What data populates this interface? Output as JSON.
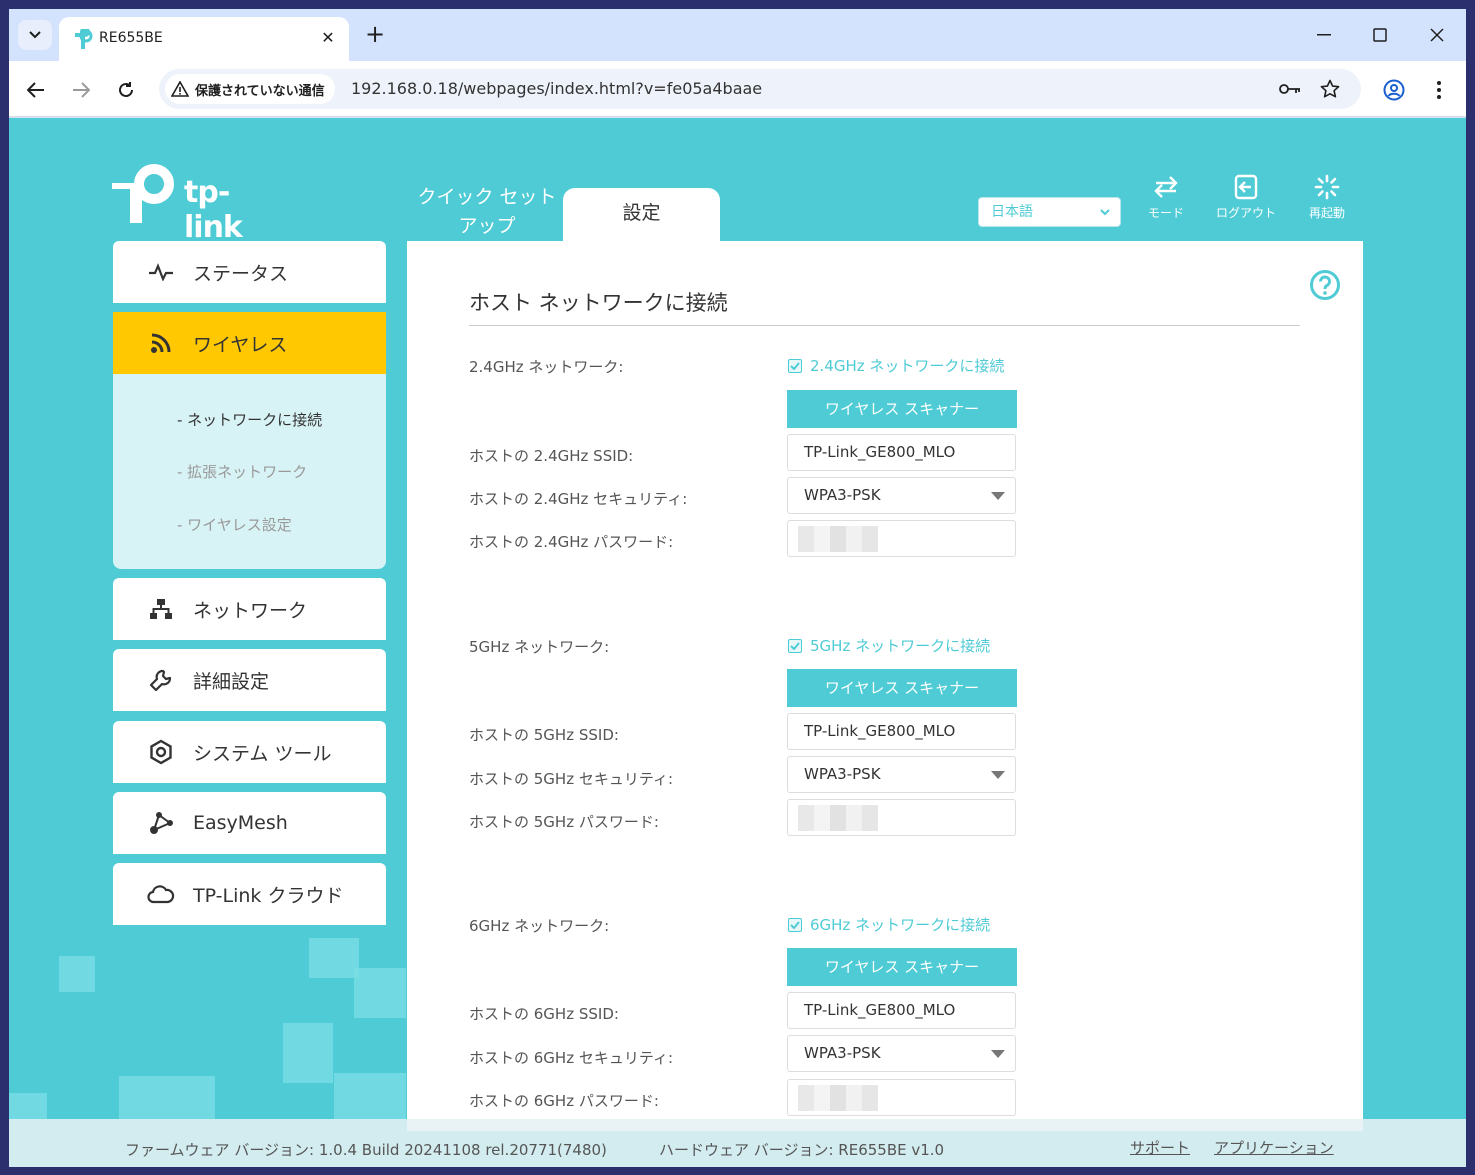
{
  "browser": {
    "tab_title": "RE655BE",
    "security_label": "保護されていない通信",
    "url": "192.168.0.18/webpages/index.html?v=fe05a4baae"
  },
  "brand": {
    "logo_text": "tp-link",
    "accent": "#4ecbd5",
    "active_menu": "#ffc800"
  },
  "header": {
    "quick_setup": "クイック セット アップ",
    "settings_tab": "設定",
    "language": "日本語",
    "mode_label": "モード",
    "logout_label": "ログアウト",
    "reboot_label": "再起動"
  },
  "sidebar": {
    "items": [
      {
        "label": "ステータス",
        "icon": "pulse-icon"
      },
      {
        "label": "ワイヤレス",
        "icon": "wifi-icon"
      },
      {
        "label": "ネットワーク",
        "icon": "network-icon"
      },
      {
        "label": "詳細設定",
        "icon": "wrench-icon"
      },
      {
        "label": "システム ツール",
        "icon": "gear-icon"
      },
      {
        "label": "EasyMesh",
        "icon": "mesh-icon"
      },
      {
        "label": "TP-Link クラウド",
        "icon": "cloud-icon"
      }
    ],
    "submenu": [
      "- ネットワークに接続",
      "- 拡張ネットワーク",
      "- ワイヤレス設定"
    ]
  },
  "main": {
    "title": "ホスト ネットワークに接続",
    "bands": [
      {
        "network_label": "2.4GHz ネットワーク:",
        "connect_label": "2.4GHz ネットワークに接続",
        "scanner_label": "ワイヤレス スキャナー",
        "ssid_label": "ホストの 2.4GHz SSID:",
        "ssid": "TP-Link_GE800_MLO",
        "security_label": "ホストの 2.4GHz セキュリティ:",
        "security": "WPA3-PSK",
        "password_label": "ホストの 2.4GHz パスワード:"
      },
      {
        "network_label": "5GHz ネットワーク:",
        "connect_label": "5GHz ネットワークに接続",
        "scanner_label": "ワイヤレス スキャナー",
        "ssid_label": "ホストの 5GHz SSID:",
        "ssid": "TP-Link_GE800_MLO",
        "security_label": "ホストの 5GHz セキュリティ:",
        "security": "WPA3-PSK",
        "password_label": "ホストの 5GHz パスワード:"
      },
      {
        "network_label": "6GHz ネットワーク:",
        "connect_label": "6GHz ネットワークに接続",
        "scanner_label": "ワイヤレス スキャナー",
        "ssid_label": "ホストの 6GHz SSID:",
        "ssid": "TP-Link_GE800_MLO",
        "security_label": "ホストの 6GHz セキュリティ:",
        "security": "WPA3-PSK",
        "password_label": "ホストの 6GHz パスワード:"
      }
    ]
  },
  "footer": {
    "firmware": "ファームウェア バージョン: 1.0.4 Build 20241108 rel.20771(7480)",
    "hardware": "ハードウェア バージョン: RE655BE v1.0",
    "support": "サポート",
    "app": "アプリケーション"
  }
}
